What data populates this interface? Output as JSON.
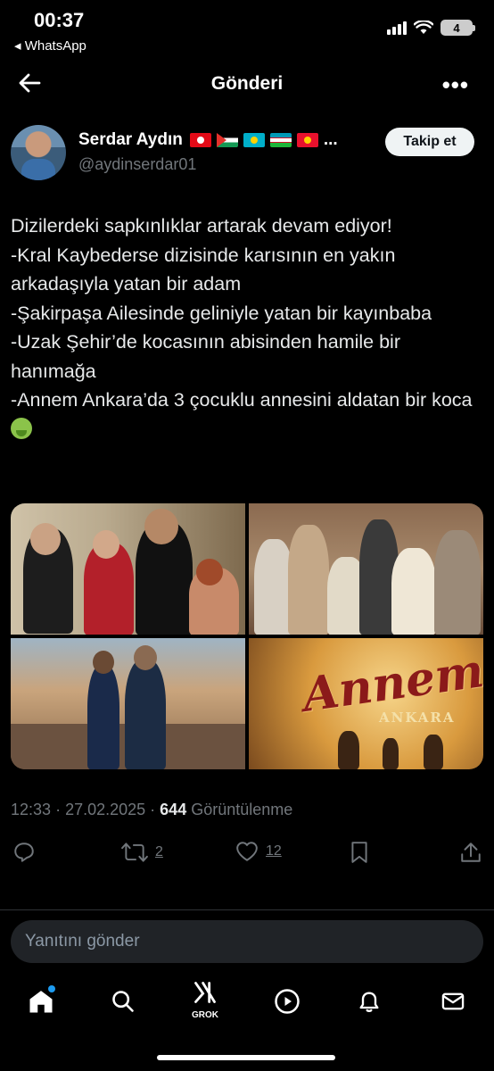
{
  "status_bar": {
    "time": "00:37",
    "back_app": "◂ WhatsApp",
    "battery": "4"
  },
  "header": {
    "title": "Gönderi"
  },
  "author": {
    "name": "Serdar Aydın",
    "handle": "@aydinserdar01",
    "flags": [
      "turkey-flag",
      "palestine-flag",
      "kazakhstan-flag",
      "uzbekistan-flag",
      "kyrgyzstan-flag"
    ],
    "ellipsis": "...",
    "follow_label": "Takip et"
  },
  "tweet": {
    "text": "Dizilerdeki sapkınlıklar artarak devam ediyor!\n-Kral Kaybederse dizisinde karısının en yakın arkadaşıyla yatan bir adam\n-Şakirpaşa Ailesinde geliniyle yatan bir kayınbaba\n-Uzak Şehir’de kocasının abisinden hamile bir hanımağa\n-Annem Ankara’da 3 çocuklu annesini aldatan bir koca",
    "emoji": "nauseated-face-emoji",
    "media": [
      {
        "name": "kral-kaybederse-photo"
      },
      {
        "name": "sakirpasa-ailesi-photo"
      },
      {
        "name": "uzak-sehir-photo"
      },
      {
        "name": "annem-ankara-poster",
        "title": "Annem",
        "subtitle": "ANKARA"
      }
    ],
    "time": "12:33",
    "date": "27.02.2025",
    "views": "644",
    "views_label": "Görüntülenme"
  },
  "actions": {
    "reply_count": "",
    "retweet_count": "2",
    "like_count": "12"
  },
  "reply_box": {
    "placeholder": "Yanıtını gönder"
  },
  "bottom_nav": {
    "grok_label": "GROK"
  },
  "colors": {
    "background": "#000000",
    "text": "#e7e9ea",
    "muted": "#71767b",
    "accent": "#1d9bf0",
    "follow_bg": "#eff3f4"
  }
}
